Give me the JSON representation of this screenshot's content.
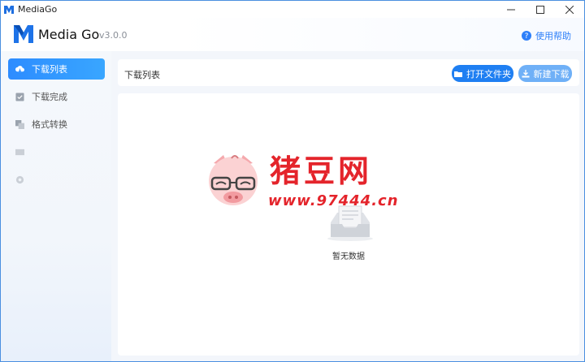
{
  "titlebar": {
    "title": "MediaGo"
  },
  "header": {
    "brand": "Media Go",
    "version": "v3.0.0",
    "help_label": "使用帮助"
  },
  "sidebar": {
    "items": [
      {
        "label": "下载列表",
        "icon": "cloud-download-icon",
        "active": true
      },
      {
        "label": "下载完成",
        "icon": "check-box-icon",
        "active": false
      },
      {
        "label": "格式转换",
        "icon": "convert-icon",
        "active": false
      },
      {
        "label": "",
        "icon": "video-icon",
        "active": false
      },
      {
        "label": "",
        "icon": "gear-icon",
        "active": false
      }
    ]
  },
  "toolbar": {
    "title": "下载列表",
    "open_folder_label": "打开文件夹",
    "new_download_label": "新建下载"
  },
  "content": {
    "empty_text": "暂无数据"
  },
  "watermark": {
    "title": "猪豆网",
    "url": "www.97444.cn"
  },
  "colors": {
    "accent": "#1f7ff2",
    "accent_light": "#6fb0f7",
    "watermark": "#e4242b"
  }
}
